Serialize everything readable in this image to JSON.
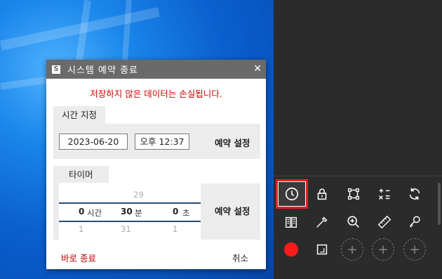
{
  "dialog": {
    "title": "시스템 예약 종료",
    "app_icon": "S",
    "close_glyph": "✕",
    "warning": "저장하지 않은 데이터는 손실됩니다.",
    "time_section": {
      "tab_label": "시간 지정",
      "date": "2023-06-20",
      "time": "오후 12:37",
      "set_label": "예약 설정"
    },
    "timer_section": {
      "tab_label": "타이머",
      "hours": {
        "prev": "",
        "value": "0",
        "next": "1",
        "unit": "시간"
      },
      "minutes": {
        "prev": "29",
        "value": "30",
        "next": "31",
        "unit": "분"
      },
      "seconds": {
        "prev": "",
        "value": "0",
        "next": "1",
        "unit": "초"
      },
      "set_label": "예약 설정"
    },
    "quit_now_label": "바로 종료",
    "cancel_label": "취소"
  },
  "toolbar": {
    "tools_row1": [
      "clock-icon",
      "lock-icon",
      "crop-icon",
      "calculator-icon",
      "refresh-icon"
    ],
    "tools_row2": [
      "book-icon",
      "eyedropper-icon",
      "zoom-in-icon",
      "ruler-icon",
      "key-icon"
    ],
    "tools_row3": [
      "record-icon",
      "screen-capture-icon",
      "add-icon",
      "add-icon",
      "add-icon"
    ],
    "plus_glyph": "+",
    "selected_tool": "clock-icon",
    "accent": "#e02020"
  },
  "colors": {
    "warning": "#d00000",
    "quit": "#b00000",
    "panel_bg": "#2b2b2b",
    "titlebar": "#6a6a6a",
    "record": "#ff1a1a"
  }
}
